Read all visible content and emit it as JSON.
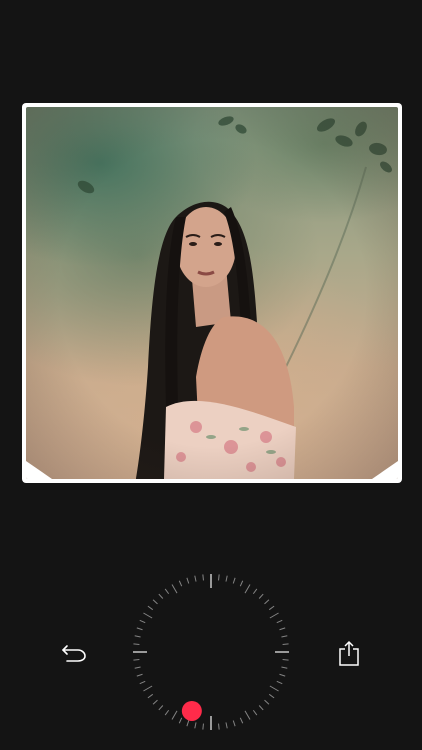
{
  "editor": {
    "photo": {
      "description_icon": "portrait-photo"
    },
    "controls": {
      "undo": {
        "icon": "undo-arrow-icon"
      },
      "share": {
        "icon": "share-icon"
      },
      "dial": {
        "icon": "rotary-dial",
        "handle_color": "#ff2b4a",
        "level": 0.55
      }
    }
  },
  "colors": {
    "background": "#141414",
    "frame": "#ffffff",
    "accent": "#ff2b4a",
    "tick": "#cfcfcf"
  }
}
